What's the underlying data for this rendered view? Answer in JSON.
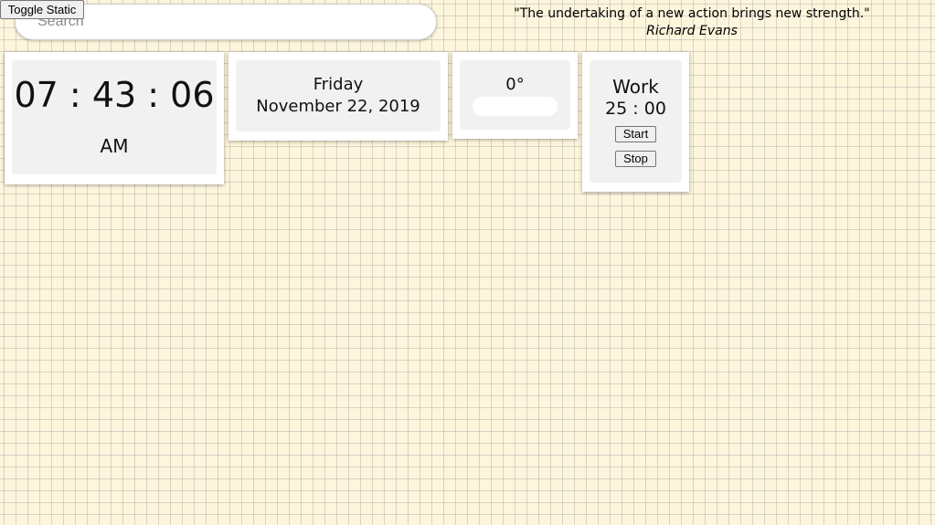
{
  "toolbar": {
    "toggle_static_label": "Toggle Static"
  },
  "search": {
    "placeholder": "Search",
    "value": ""
  },
  "quote": {
    "text": "\"The undertaking of a new action brings new strength.\"",
    "author": "Richard Evans"
  },
  "clock": {
    "hours": "07",
    "separator1": ":",
    "minutes": "43",
    "separator2": ":",
    "seconds": "06",
    "period": "AM"
  },
  "date": {
    "weekday": "Friday",
    "full_date": "November 22, 2019"
  },
  "weather": {
    "temperature": "0°"
  },
  "timer": {
    "mode": "Work",
    "minutes": "25",
    "separator": ":",
    "seconds": "00",
    "start_label": "Start",
    "stop_label": "Stop"
  },
  "colors": {
    "background": "#fdf6dc",
    "grid_line": "#aaaaaa",
    "card": "#ffffff",
    "card_inner": "#f1f1f1"
  }
}
